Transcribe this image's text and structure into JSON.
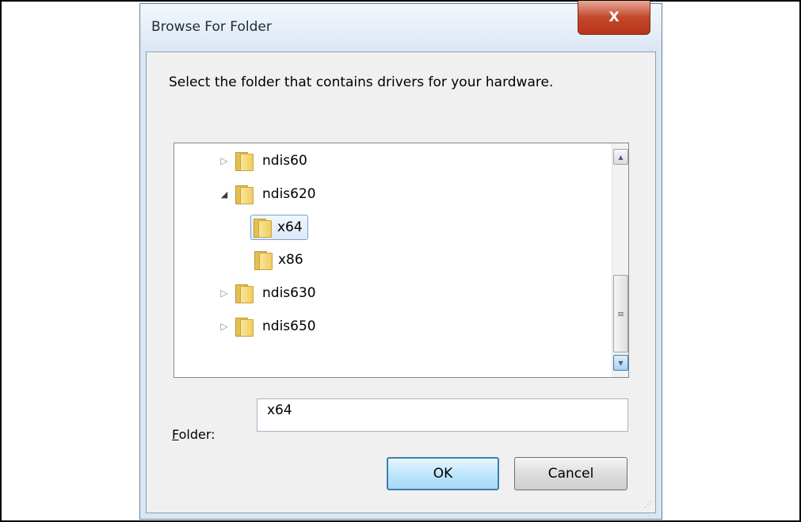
{
  "dialog": {
    "title": "Browse For Folder",
    "close_label": "X",
    "instruction": "Select the folder that contains drivers for your hardware."
  },
  "tree": {
    "items": [
      {
        "label": "ndis60",
        "expander": "▷",
        "selected": false
      },
      {
        "label": "ndis620",
        "expander": "◢",
        "selected": false
      },
      {
        "label": "x64",
        "expander": "",
        "selected": true
      },
      {
        "label": "x86",
        "expander": "",
        "selected": false
      },
      {
        "label": "ndis630",
        "expander": "▷",
        "selected": false
      },
      {
        "label": "ndis650",
        "expander": "▷",
        "selected": false
      }
    ],
    "scroll_up_glyph": "▲",
    "scroll_down_glyph": "▼",
    "thumb_glyph": "≡"
  },
  "folder_field": {
    "label_underlined": "F",
    "label_rest": "older:",
    "value": "x64"
  },
  "buttons": {
    "ok": "OK",
    "cancel": "Cancel"
  },
  "grip_glyph": "⋰"
}
